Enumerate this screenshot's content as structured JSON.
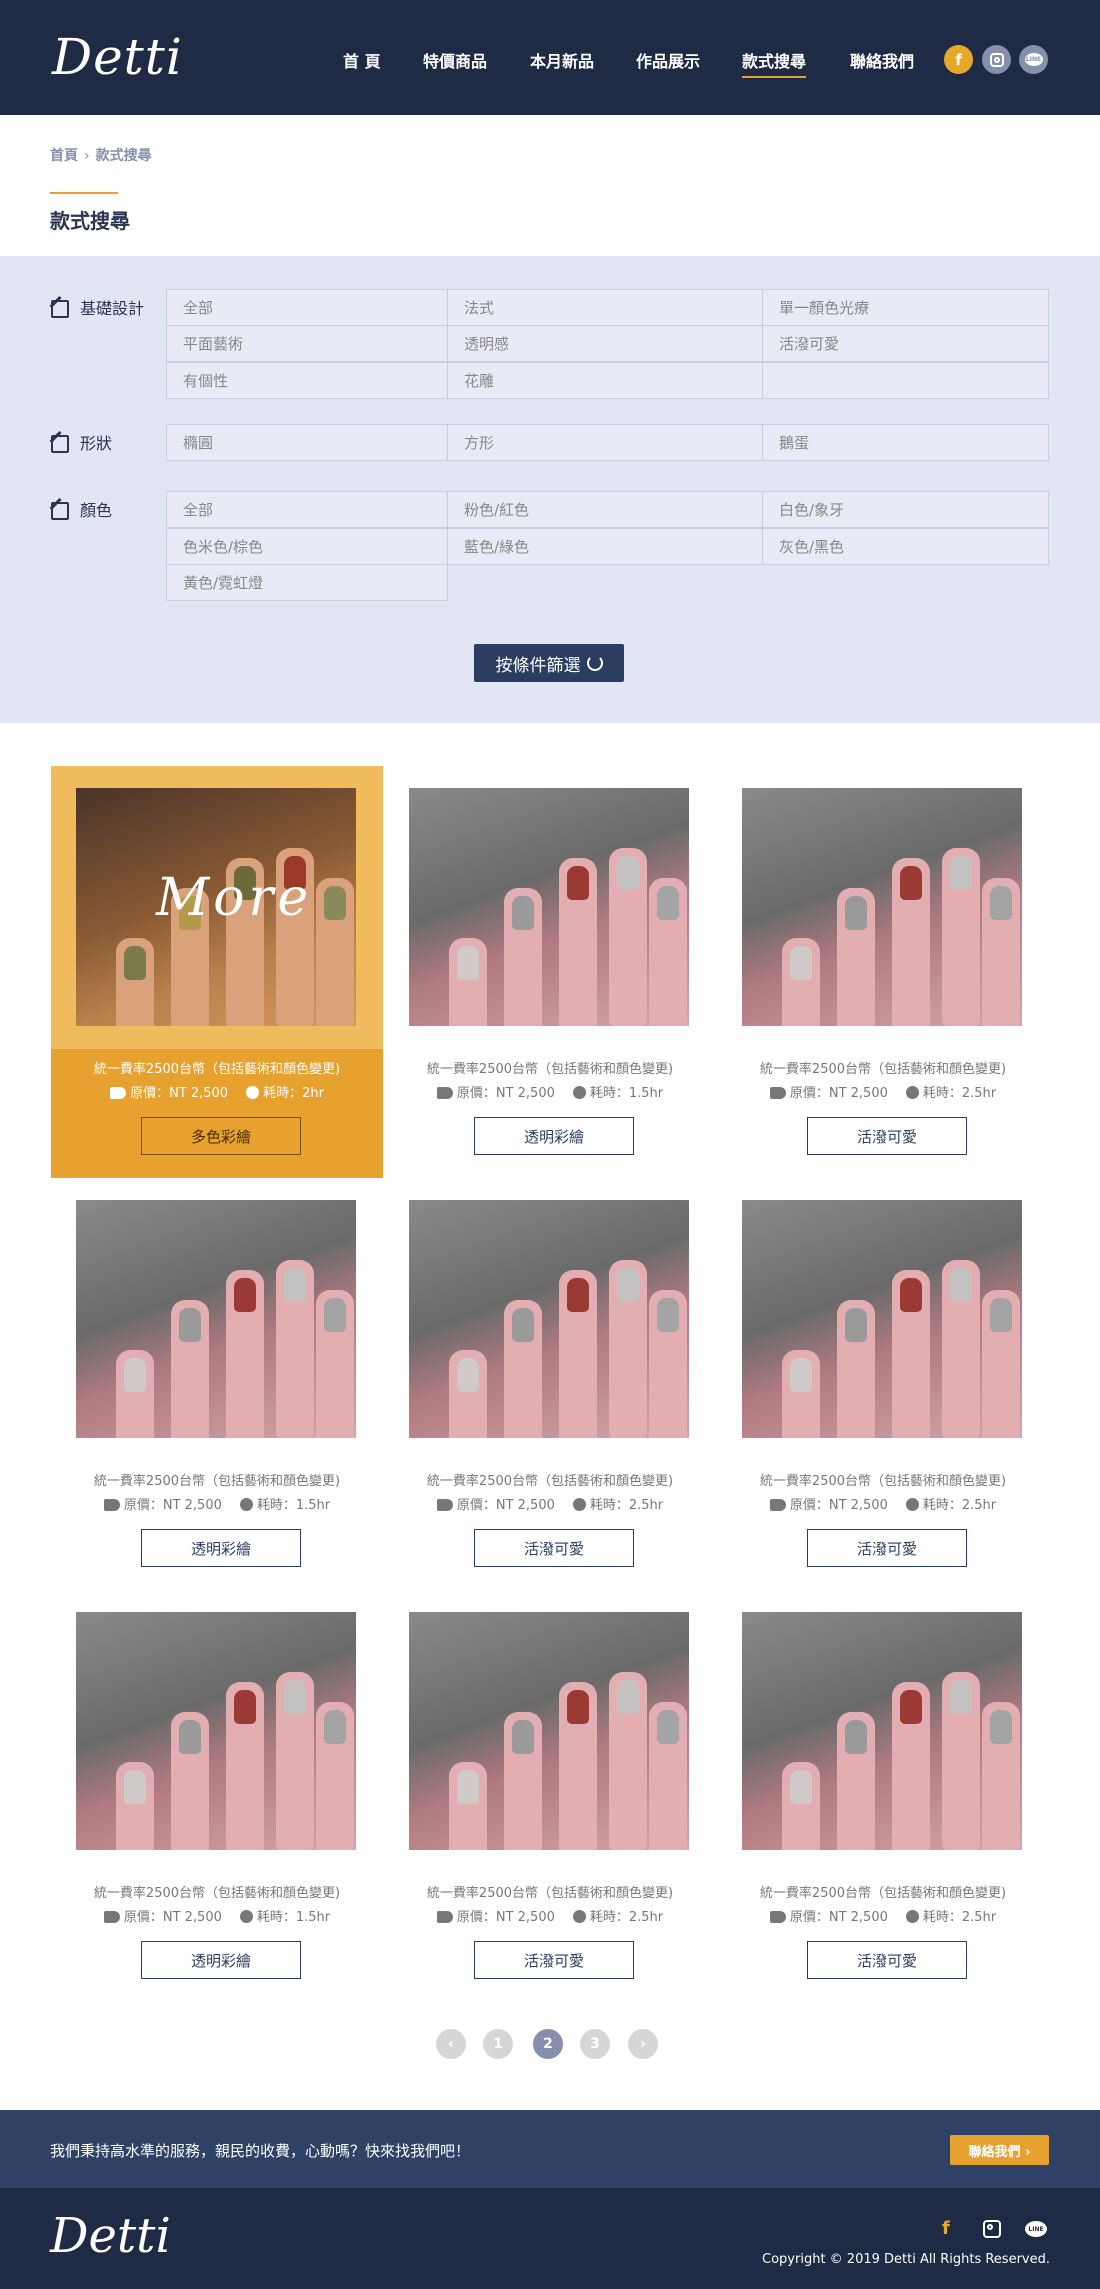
{
  "header": {
    "logo": "Detti",
    "nav": [
      "首 頁",
      "特價商品",
      "本月新品",
      "作品展示",
      "款式搜尋",
      "聯絡我們"
    ],
    "active_nav": "款式搜尋",
    "social": [
      "f",
      "instagram",
      "LINE"
    ]
  },
  "breadcrumb": {
    "home": "首頁",
    "separator": "›",
    "current": "款式搜尋"
  },
  "page_title": "款式搜尋",
  "filters": {
    "design": {
      "label": "基礎設計",
      "options": [
        "全部",
        "法式",
        "單一顏色光療",
        "平面藝術",
        "透明感",
        "活潑可愛",
        "有個性",
        "花雕",
        ""
      ]
    },
    "shape": {
      "label": "形狀",
      "options": [
        "橢圓",
        "方形",
        "鵝蛋"
      ]
    },
    "color": {
      "label": "顏色",
      "options": [
        "全部",
        "粉色/紅色",
        "白色/象牙",
        "色米色/棕色",
        "藍色/綠色",
        "灰色/黑色",
        "黃色/霓虹燈"
      ]
    },
    "submit_label": "按條件篩選"
  },
  "products": [
    {
      "featured": true,
      "overlay": "More",
      "desc": "統一費率2500台幣（包括藝術和顏色變更)",
      "price": "原價：NT 2,500",
      "time": "耗時：2hr",
      "style": "多色彩繪"
    },
    {
      "desc": "統一費率2500台幣（包括藝術和顏色變更)",
      "price": "原價：NT 2,500",
      "time": "耗時：1.5hr",
      "style": "透明彩繪"
    },
    {
      "desc": "統一費率2500台幣（包括藝術和顏色變更)",
      "price": "原價：NT 2,500",
      "time": "耗時：2.5hr",
      "style": "活潑可愛"
    },
    {
      "desc": "統一費率2500台幣（包括藝術和顏色變更)",
      "price": "原價：NT 2,500",
      "time": "耗時：1.5hr",
      "style": "透明彩繪"
    },
    {
      "desc": "統一費率2500台幣（包括藝術和顏色變更)",
      "price": "原價：NT 2,500",
      "time": "耗時：2.5hr",
      "style": "活潑可愛"
    },
    {
      "desc": "統一費率2500台幣（包括藝術和顏色變更)",
      "price": "原價：NT 2,500",
      "time": "耗時：2.5hr",
      "style": "活潑可愛"
    },
    {
      "desc": "統一費率2500台幣（包括藝術和顏色變更)",
      "price": "原價：NT 2,500",
      "time": "耗時：1.5hr",
      "style": "透明彩繪"
    },
    {
      "desc": "統一費率2500台幣（包括藝術和顏色變更)",
      "price": "原價：NT 2,500",
      "time": "耗時：2.5hr",
      "style": "活潑可愛"
    },
    {
      "desc": "統一費率2500台幣（包括藝術和顏色變更)",
      "price": "原價：NT 2,500",
      "time": "耗時：2.5hr",
      "style": "活潑可愛"
    }
  ],
  "pagination": {
    "prev": "‹",
    "pages": [
      "1",
      "2",
      "3"
    ],
    "current": "2",
    "next": "›"
  },
  "cta": {
    "text": "我們秉持高水準的服務，親民的收費，心動嗎？快來找我們吧！",
    "button": "聯絡我們 ›"
  },
  "footer": {
    "logo": "Detti",
    "copyright": "Copyright © 2019 Detti All Rights Reserved."
  },
  "colors": {
    "navy": "#1f2a45",
    "accent": "#e6a12e",
    "filter_bg": "#e2e6f4"
  }
}
